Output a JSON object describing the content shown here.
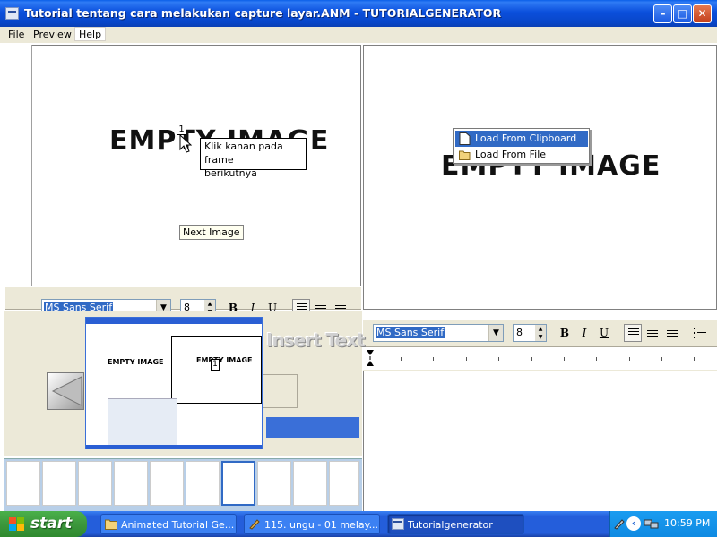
{
  "window": {
    "title": "Tutorial tentang cara melakukan capture layar.ANM - TUTORIALGENERATOR",
    "minimize_symbol": "–",
    "maximize_symbol": "□",
    "close_symbol": "✕"
  },
  "menu": {
    "items": [
      "File",
      "Preview",
      "Help"
    ]
  },
  "left_panel": {
    "placeholder": "EMPTY IMAGE",
    "marker_number": "1",
    "tooltip_line1": "Klik kanan pada frame",
    "tooltip_line2": "berikutnya",
    "next_button": "Next Image"
  },
  "right_panel": {
    "placeholder": "EMPTY IMAGE",
    "context_menu": [
      "Load From Clipboard",
      "Load From File"
    ]
  },
  "format_toolbar_left": {
    "font": "MS Sans Serif",
    "size": "8",
    "bold": "B",
    "italic": "I",
    "underline": "U"
  },
  "format_toolbar_right": {
    "font": "MS Sans Serif",
    "size": "8",
    "bold": "B",
    "italic": "I",
    "underline": "U"
  },
  "preview": {
    "insert_text": "Insert Text",
    "mini_empty_left": "EMPTY IMAGE",
    "mini_empty_right": "EMPTY IMAGE",
    "mini_marker": "1"
  },
  "taskbar": {
    "start_label": "start",
    "tasks": [
      "Animated Tutorial Ge...",
      "115. ungu - 01 melay...",
      "Tutorialgenerator"
    ],
    "clock": "10:59 PM"
  },
  "colors": {
    "title_blue": "#0846c8",
    "selection": "#316ac5",
    "start_green": "#3c973c",
    "taskbar_blue": "#245edb"
  }
}
